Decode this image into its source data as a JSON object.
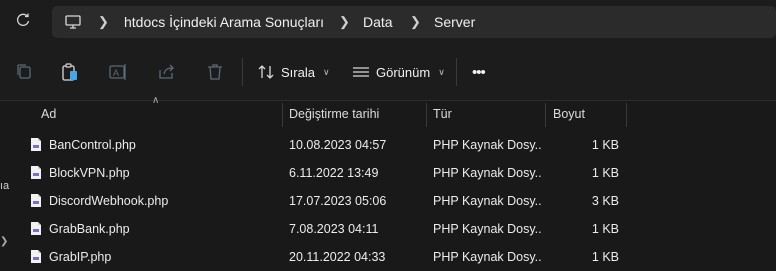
{
  "address": {
    "crumbs": [
      "htdocs İçindeki Arama Sonuçları",
      "Data",
      "Server"
    ]
  },
  "toolbar": {
    "sort_label": "Sırala",
    "view_label": "Görünüm",
    "more_label": "•••"
  },
  "columns": {
    "name": "Ad",
    "modified": "Değiştirme tarihi",
    "type": "Tür",
    "size": "Boyut"
  },
  "files": [
    {
      "name": "BanControl.php",
      "modified": "10.08.2023 04:57",
      "type": "PHP Kaynak Dosy...",
      "size": "1 KB"
    },
    {
      "name": "BlockVPN.php",
      "modified": "6.11.2022 13:49",
      "type": "PHP Kaynak Dosy...",
      "size": "1 KB"
    },
    {
      "name": "DiscordWebhook.php",
      "modified": "17.07.2023 05:06",
      "type": "PHP Kaynak Dosy...",
      "size": "3 KB"
    },
    {
      "name": "GrabBank.php",
      "modified": "7.08.2023 04:11",
      "type": "PHP Kaynak Dosy...",
      "size": "1 KB"
    },
    {
      "name": "GrabIP.php",
      "modified": "20.11.2022 04:33",
      "type": "PHP Kaynak Dosy...",
      "size": "1 KB"
    }
  ],
  "left_pane_fragment": "ıa"
}
